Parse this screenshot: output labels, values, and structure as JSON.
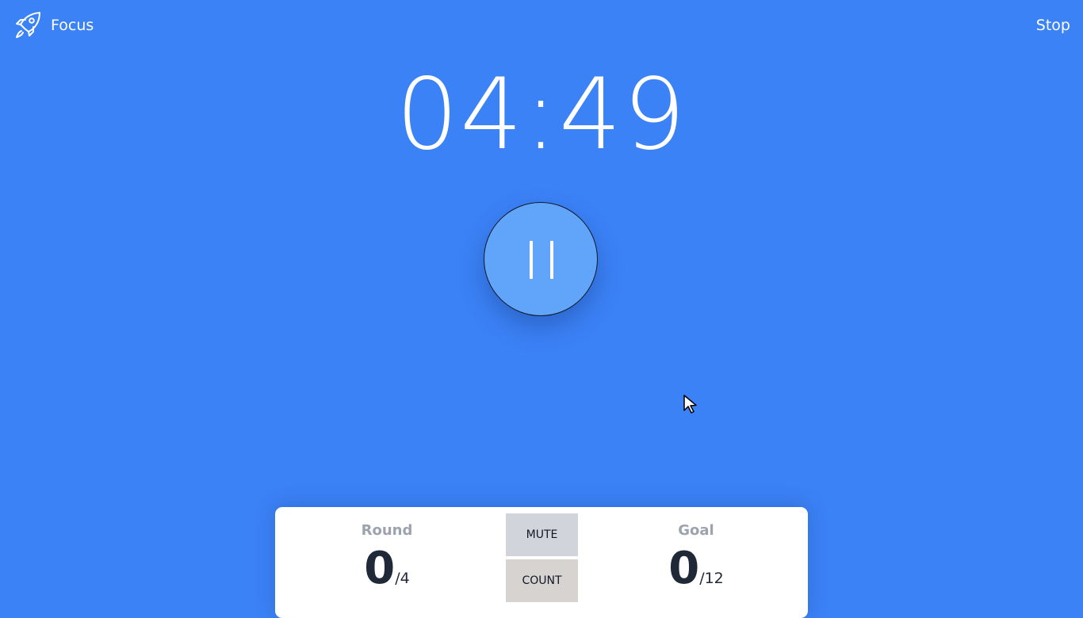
{
  "header": {
    "brand_label": "Focus",
    "brand_icon": "rocket-icon",
    "stop_label": "Stop"
  },
  "timer": {
    "display": "04:49",
    "control_icon": "pause-icon",
    "state": "running"
  },
  "stats": {
    "round": {
      "label": "Round",
      "value": "0",
      "total": "/4"
    },
    "goal": {
      "label": "Goal",
      "value": "0",
      "total": "/12"
    }
  },
  "controls": {
    "mute_label": "MUTE",
    "count_label": "COUNT"
  },
  "colors": {
    "background": "#3b82f6",
    "pause_button": "#60a5fa",
    "panel": "#ffffff",
    "stat_label": "#9ca3af",
    "mute_button": "#d1d5db",
    "count_button": "#d6d3d1"
  }
}
